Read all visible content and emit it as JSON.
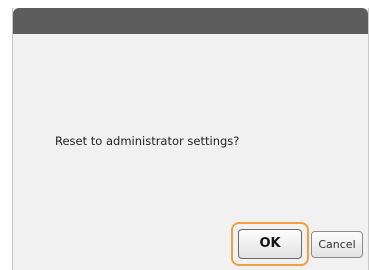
{
  "dialog": {
    "message": "Reset to administrator settings?",
    "ok_label": "OK",
    "cancel_label": "Cancel"
  },
  "colors": {
    "titlebar": "#5d5d5d",
    "dialog_background": "#f1f1f1",
    "highlight": "#f0a040"
  }
}
